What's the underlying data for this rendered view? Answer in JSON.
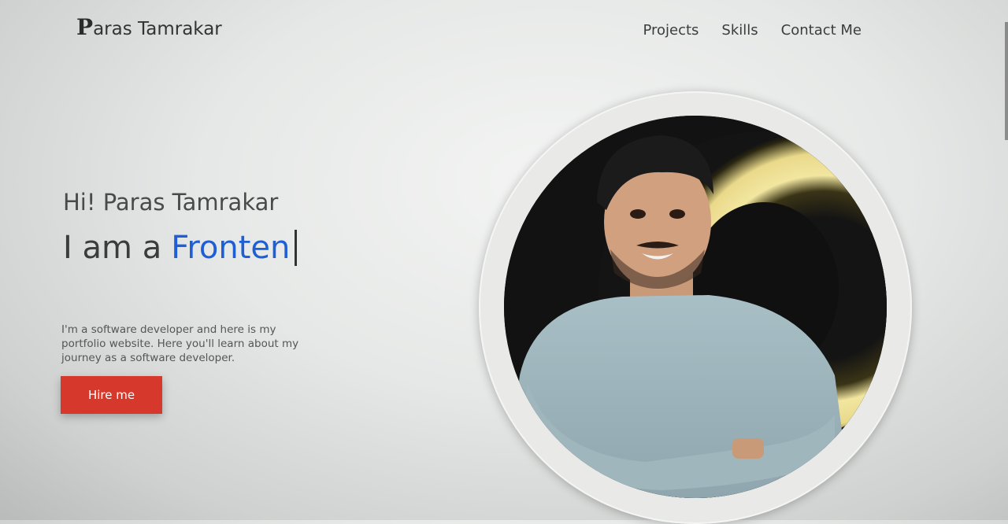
{
  "header": {
    "logo_letter": "P",
    "brand_rest": "aras Tamrakar",
    "nav": [
      {
        "label": "Projects"
      },
      {
        "label": "Skills"
      },
      {
        "label": "Contact Me"
      }
    ]
  },
  "hero": {
    "greeting": "Hi! Paras Tamrakar",
    "role_prefix": "I am a",
    "role_word": "Fronten",
    "description": "I'm a software developer and here is my portfolio website. Here you'll learn about my journey as a software developer.",
    "cta_label": "Hire me"
  },
  "colors": {
    "accent_blue": "#1f5fd6",
    "cta_red": "#d6392c"
  }
}
